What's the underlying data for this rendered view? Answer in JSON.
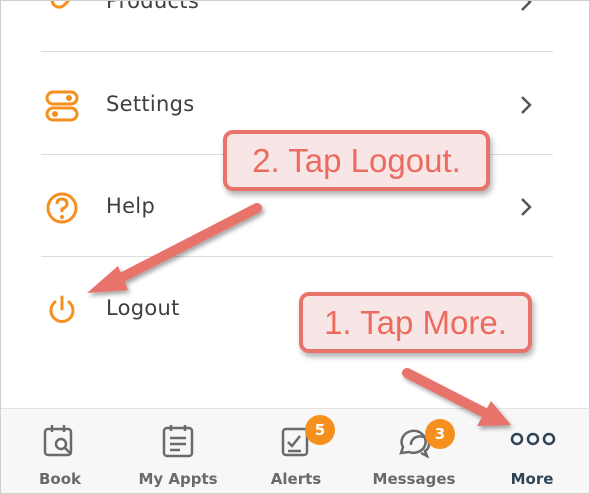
{
  "menu": {
    "items": [
      {
        "label": "Products",
        "icon": "tag-icon"
      },
      {
        "label": "Settings",
        "icon": "toggle-settings-icon"
      },
      {
        "label": "Help",
        "icon": "question-circle-icon"
      },
      {
        "label": "Logout",
        "icon": "power-icon"
      }
    ]
  },
  "tabbar": {
    "tabs": [
      {
        "label": "Book",
        "icon": "calendar-search-icon"
      },
      {
        "label": "My Appts",
        "icon": "clipboard-icon"
      },
      {
        "label": "Alerts",
        "icon": "checklist-icon",
        "badge": "5"
      },
      {
        "label": "Messages",
        "icon": "chat-bubbles-icon",
        "badge": "3"
      },
      {
        "label": "More",
        "icon": "more-dots-icon",
        "active": true
      }
    ]
  },
  "annotations": {
    "step1": "1. Tap More.",
    "step2": "2. Tap Logout."
  },
  "colors": {
    "accent_orange": "#f5901e",
    "callout_red": "#e8736a",
    "callout_fill": "#f8e6e6",
    "active_tab": "#2f4458"
  }
}
